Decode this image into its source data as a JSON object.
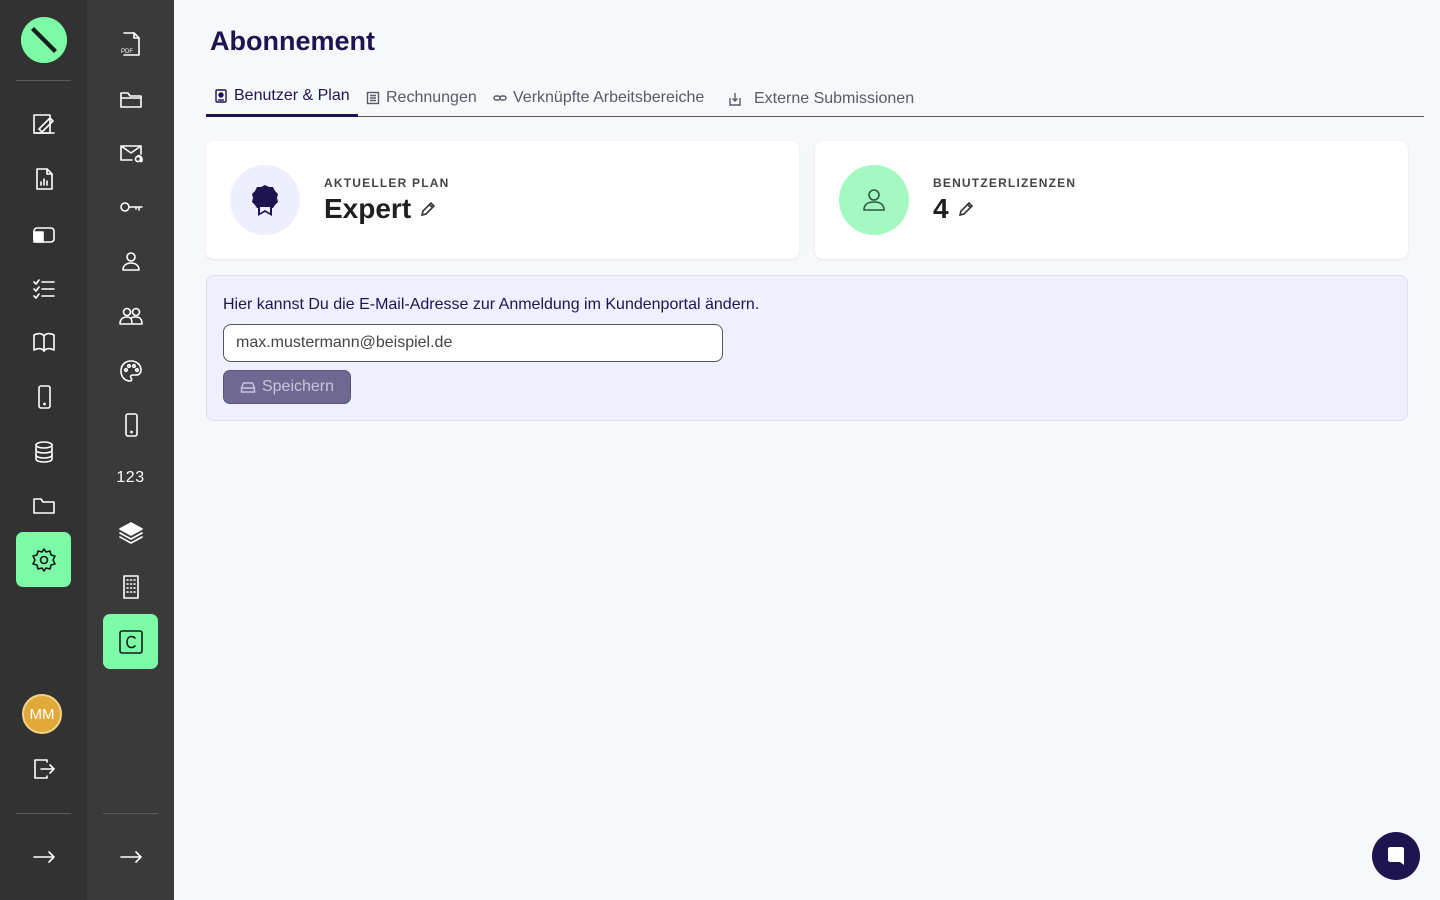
{
  "page": {
    "title": "Abonnement"
  },
  "tabs": [
    {
      "label": "Benutzer & Plan",
      "icon": "id-badge-icon",
      "active": true
    },
    {
      "label": "Rechnungen",
      "icon": "receipt-icon",
      "active": false
    },
    {
      "label": "Verknüpfte Arbeitsbereiche",
      "icon": "link-icon",
      "active": false
    },
    {
      "label": "Externe Submissionen",
      "icon": "download-box-icon",
      "active": false
    }
  ],
  "cards": {
    "plan": {
      "label": "AKTUELLER PLAN",
      "value": "Expert",
      "icon": "award-icon"
    },
    "licenses": {
      "label": "BENUTZERLIZENZEN",
      "value": "4",
      "icon": "user-icon"
    }
  },
  "email": {
    "hint": "Hier kannst Du die E-Mail-Adresse zur Anmeldung im Kundenportal ändern.",
    "value": "max.mustermann@beispiel.de",
    "save_label": "Speichern"
  },
  "rail2": {
    "numbers_label": "123"
  },
  "user": {
    "initials": "MM"
  },
  "colors": {
    "accent": "#7dfca8",
    "primary": "#1e1450",
    "rail_dark": "#323232"
  }
}
